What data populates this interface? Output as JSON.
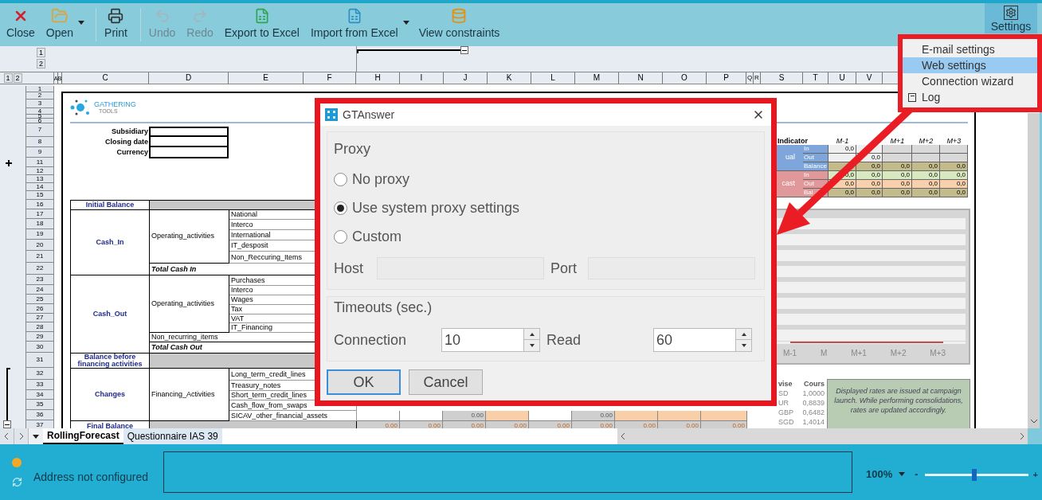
{
  "toolbar": {
    "items": [
      {
        "kind": "close",
        "label": "Close",
        "disabled": false,
        "dropdown": false
      },
      {
        "kind": "open",
        "label": "Open",
        "disabled": false,
        "dropdown": true
      },
      {
        "kind": "separator"
      },
      {
        "kind": "print",
        "label": "Print",
        "disabled": false,
        "dropdown": false
      },
      {
        "kind": "separator"
      },
      {
        "kind": "undo",
        "label": "Undo",
        "disabled": true,
        "dropdown": false
      },
      {
        "kind": "redo",
        "label": "Redo",
        "disabled": true,
        "dropdown": false
      },
      {
        "kind": "export",
        "label": "Export to Excel",
        "disabled": false,
        "dropdown": false
      },
      {
        "kind": "import",
        "label": "Import from Excel",
        "disabled": false,
        "dropdown": true
      },
      {
        "kind": "constraints",
        "label": "View constraints",
        "disabled": false,
        "dropdown": false
      }
    ],
    "settings": {
      "label": "Settings",
      "selected": true
    }
  },
  "settings_menu": {
    "items": [
      {
        "label": "E-mail settings",
        "selected": false,
        "has_icon": false
      },
      {
        "label": "Web settings",
        "selected": true,
        "has_icon": false
      },
      {
        "label": "Connection wizard",
        "selected": false,
        "has_icon": false
      },
      {
        "label": "Log",
        "selected": false,
        "has_icon": true
      }
    ]
  },
  "outline": {
    "column_levels": [
      "1",
      "2"
    ],
    "row_levels": [
      "1",
      "2"
    ]
  },
  "sheet": {
    "columns": [
      "A",
      "B",
      "C",
      "D",
      "E",
      "F",
      "H",
      "I",
      "J",
      "K",
      "L",
      "M",
      "N",
      "O",
      "P",
      "Q",
      "R",
      "S",
      "T",
      "U",
      "V"
    ],
    "row_numbers": [
      "1",
      "2",
      "3",
      "4",
      "5",
      "6",
      "7",
      "8",
      "9",
      "11",
      "12",
      "13",
      "14",
      "15",
      "16",
      "17",
      "18",
      "19",
      "20",
      "21",
      "22",
      "23",
      "24",
      "25",
      "26",
      "27",
      "28",
      "29",
      "30",
      "31",
      "32",
      "33",
      "34",
      "35",
      "36",
      "37"
    ]
  },
  "logo": {
    "name": "GATHERING",
    "sub": "TOOLS"
  },
  "form": {
    "labels": [
      "Subsidiary",
      "Closing date",
      "Currency"
    ]
  },
  "cash_table": {
    "sections": [
      {
        "kind": "balance",
        "label": "Initial Balance"
      },
      {
        "kind": "group",
        "label": "Cash_In",
        "activity": {
          "label": "Operating_activities",
          "items": [
            "National",
            "Interco",
            "International",
            "IT_desposit",
            "Non_Reccuring_Items"
          ]
        },
        "total": "Total Cash In"
      },
      {
        "kind": "group",
        "label": "Cash_Out",
        "activity": {
          "label": "Operating_activities",
          "items": [
            "Purchases",
            "Interco",
            "Wages",
            "Tax",
            "VAT",
            "IT_Financing"
          ]
        },
        "extras": [
          "Non_recurring_items"
        ],
        "total": "Total Cash Out"
      },
      {
        "kind": "balance",
        "label": "Balance before financing activities"
      },
      {
        "kind": "group",
        "label": "Changes",
        "activity": {
          "label": "Financing_Activities",
          "items": [
            "Long_term_credit_lines",
            "Treasury_notes",
            "Short_term_credit_lines",
            "Cash_flow_from_swaps",
            "SICAV_other_financial_assets"
          ]
        }
      },
      {
        "kind": "balance",
        "label": "Final Balance"
      }
    ],
    "value_rows": [
      {
        "cells": [
          {
            "kind": "white"
          },
          {
            "kind": "white"
          },
          {
            "kind": "gray",
            "text": "0.00"
          },
          {
            "kind": "orange"
          },
          {
            "kind": "white"
          },
          {
            "kind": "gray",
            "text": "0.00"
          },
          {
            "kind": "orange"
          },
          {
            "kind": "orange"
          },
          {
            "kind": "orange"
          }
        ]
      },
      {
        "cells": [
          {
            "kind": "total",
            "text": "0.00"
          },
          {
            "kind": "total",
            "text": "0.00"
          },
          {
            "kind": "total",
            "text": "0.00"
          },
          {
            "kind": "total",
            "text": "0.00"
          },
          {
            "kind": "total",
            "text": "0.00"
          },
          {
            "kind": "total",
            "text": "0.00"
          },
          {
            "kind": "total",
            "text": "0.00"
          },
          {
            "kind": "total",
            "text": "0.00"
          },
          {
            "kind": "total",
            "text": "0.00"
          }
        ]
      }
    ]
  },
  "indicator": {
    "title": "Indicator",
    "columns": [
      {
        "kind": "label",
        "label": "M-1"
      },
      {
        "kind": "blank"
      },
      {
        "kind": "label",
        "label": "M+1"
      },
      {
        "kind": "label",
        "label": "M+2"
      },
      {
        "kind": "label",
        "label": "M+3"
      }
    ],
    "groups": [
      {
        "label": "ual",
        "color": "#7ea6db",
        "rows": [
          {
            "label": "In",
            "cells": [
              {
                "kind": "plain",
                "text": "0,0"
              },
              {
                "kind": "plain"
              },
              {
                "kind": "hatched"
              },
              {
                "kind": "hatched"
              },
              {
                "kind": "hatched"
              }
            ]
          },
          {
            "label": "Out",
            "cells": [
              {
                "kind": "plain"
              },
              {
                "kind": "plain",
                "text": "0,0"
              },
              {
                "kind": "hatched"
              },
              {
                "kind": "hatched"
              },
              {
                "kind": "hatched"
              }
            ]
          },
          {
            "label": "Balance",
            "cells": [
              {
                "kind": "olive"
              },
              {
                "kind": "olive",
                "text": "0,0"
              },
              {
                "kind": "olive",
                "text": "0,0"
              },
              {
                "kind": "olive",
                "text": "0,0"
              },
              {
                "kind": "olive",
                "text": "0,0"
              }
            ]
          }
        ]
      },
      {
        "label": "cast",
        "color": "#e0989a",
        "rows": [
          {
            "label": "In",
            "cells": [
              {
                "kind": "green",
                "text": "0,0"
              },
              {
                "kind": "green",
                "text": "0,0"
              },
              {
                "kind": "green",
                "text": "0,0"
              },
              {
                "kind": "green",
                "text": "0,0"
              },
              {
                "kind": "green",
                "text": "0,0"
              }
            ]
          },
          {
            "label": "Out",
            "cells": [
              {
                "kind": "orange",
                "text": "0,0"
              },
              {
                "kind": "orange",
                "text": "0,0"
              },
              {
                "kind": "orange",
                "text": "0,0"
              },
              {
                "kind": "orange",
                "text": "0,0"
              },
              {
                "kind": "orange",
                "text": "0,0"
              }
            ]
          },
          {
            "label": "Bal",
            "cells": [
              {
                "kind": "olive",
                "text": "0,0"
              },
              {
                "kind": "olive",
                "text": "0,0"
              },
              {
                "kind": "olive",
                "text": "0,0"
              },
              {
                "kind": "olive",
                "text": "0,0"
              },
              {
                "kind": "olive",
                "text": "0,0"
              }
            ]
          }
        ]
      }
    ]
  },
  "chart": {
    "x_labels": [
      "M-1",
      "M",
      "M+1",
      "M+2",
      "M+3"
    ]
  },
  "currency": {
    "headers": [
      "vise",
      "Cours"
    ],
    "rows": [
      [
        "SD",
        "1,0000"
      ],
      [
        "UR",
        "0,8839"
      ],
      [
        "GBP",
        "0,6482"
      ],
      [
        "SGD",
        "1,4014"
      ]
    ],
    "note": "Displayed rates are issued at campaign launch. While performing consolidations, rates are updated accordingly."
  },
  "sheet_tabs": [
    {
      "label": "RollingForecast",
      "selected": true
    },
    {
      "label": "Questionnaire IAS 39",
      "selected": false
    }
  ],
  "status": {
    "message": "Address not configured",
    "zoom": "100%",
    "zoom_out": "-",
    "zoom_in": "+",
    "zoom_slider": {
      "level": 0.48
    }
  },
  "dialog": {
    "title": "GTAnswer",
    "proxy": {
      "legend": "Proxy",
      "options": [
        {
          "label": "No proxy",
          "selected": false
        },
        {
          "label": "Use system proxy settings",
          "selected": true
        },
        {
          "label": "Custom",
          "selected": false
        }
      ],
      "host": {
        "label": "Host",
        "disabled": true
      },
      "port": {
        "label": "Port",
        "disabled": true
      }
    },
    "timeouts": {
      "legend": "Timeouts (sec.)",
      "connection": {
        "label": "Connection",
        "value": "10"
      },
      "read": {
        "label": "Read",
        "value": "60"
      }
    },
    "buttons": [
      {
        "label": "OK",
        "focused": true
      },
      {
        "label": "Cancel",
        "focused": false
      }
    ]
  }
}
